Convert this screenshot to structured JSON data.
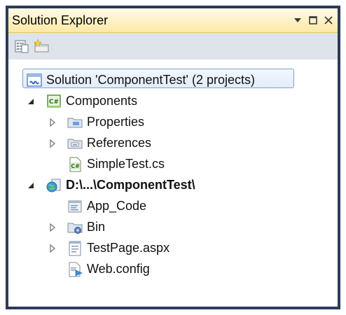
{
  "window": {
    "title": "Solution Explorer",
    "buttons": [
      "dropdown-arrow-icon",
      "maximize-icon",
      "close-icon"
    ]
  },
  "toolbar": {
    "tools": [
      {
        "name": "properties-icon"
      },
      {
        "name": "show-all-files-icon"
      }
    ]
  },
  "tree": {
    "solution": {
      "label": "Solution 'ComponentTest' (2 projects)",
      "icon": "solution-icon",
      "selected": true
    },
    "project1": {
      "label": "Components",
      "icon": "csharp-project-icon",
      "children": [
        {
          "label": "Properties",
          "icon": "properties-folder-icon"
        },
        {
          "label": "References",
          "icon": "references-icon"
        },
        {
          "label": "SimpleTest.cs",
          "icon": "csharp-file-icon"
        }
      ]
    },
    "project2": {
      "label": "D:\\...\\ComponentTest\\",
      "icon": "website-project-icon",
      "children": [
        {
          "label": "App_Code",
          "icon": "app-code-folder-icon"
        },
        {
          "label": "Bin",
          "icon": "bin-folder-icon"
        },
        {
          "label": "TestPage.aspx",
          "icon": "aspx-file-icon"
        },
        {
          "label": "Web.config",
          "icon": "config-file-icon"
        }
      ]
    }
  },
  "colors": {
    "frame": "#2b3c59",
    "titlebar_top": "#fffbe9",
    "titlebar_bottom": "#ffe8a6",
    "toolbar": "#dfe3ea",
    "selection_border": "#7da2ce"
  }
}
